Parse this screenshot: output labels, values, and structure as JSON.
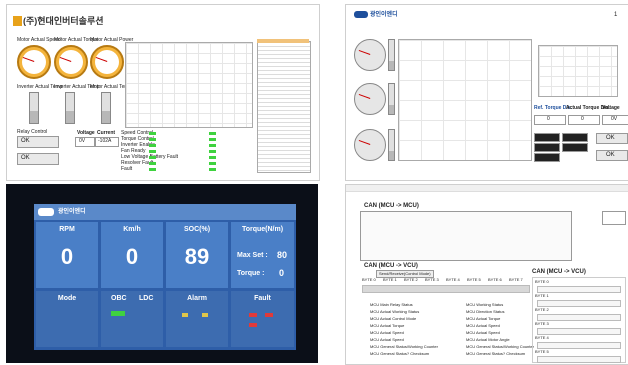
{
  "panel1": {
    "company": "(주)현대인버터솔루션",
    "gauge_labels": [
      "Motor Actual Speed",
      "Motor Actual Torque",
      "Motor Actual Power"
    ],
    "bar_labels": [
      "Inverter Actual Temp",
      "Inverter Actual Temp",
      "Motor Actual Temp"
    ],
    "status_label": "Relay Control",
    "status_ok": "OK",
    "status_ok2": "OK",
    "voltage_label": "Voltage",
    "current_label": "Current",
    "voltage_value": "0V",
    "current_value": "-102A",
    "list_items": [
      "Speed Control",
      "Torque Control",
      "Inverter Enable",
      "Fan Ready",
      "Low Voltage Battery Fault",
      "Resolver Fault",
      "Fault"
    ]
  },
  "panel2": {
    "company": "광인이엔디",
    "corner_label": "1",
    "fields": [
      "Ref. Torque Dis.",
      "Actual Torque Dis.",
      "Voltage",
      "Current"
    ],
    "values": [
      "0",
      "0",
      "0V",
      "-10"
    ],
    "ok_label": "OK",
    "ok_label2": "OK"
  },
  "panel3": {
    "brand": "광인이엔디",
    "tiles_top": [
      {
        "label": "RPM",
        "value": "0"
      },
      {
        "label": "Km/h",
        "value": "0"
      },
      {
        "label": "SOC(%)",
        "value": "89"
      },
      {
        "label": "Torque(N/m)",
        "value": ""
      }
    ],
    "max_set_label": "Max Set :",
    "max_set_value": "80",
    "torque_label": "Torque :",
    "torque_value": "0",
    "tiles_bottom": [
      "Mode",
      "OBC",
      "LDC",
      "Alarm",
      "Fault"
    ]
  },
  "panel4": {
    "title_top": "CAN (MCU -> MCU)",
    "title_mid": "CAN (MCU -> VCU)",
    "title_right": "CAN (MCU -> VCU)",
    "tab_label": "Send/Receive(Control Mode)",
    "bytes": [
      "BYTE 0",
      "BYTE 1",
      "BYTE 2",
      "BYTE 3",
      "BYTE 4",
      "BYTE 5",
      "BYTE 6",
      "BYTE 7"
    ],
    "left_rows": [
      "MCU Main Relay Status",
      "MCU Actual Working Status",
      "MCU Actual Control Mode",
      "MCU Actual Torque",
      "MCU Actual Speed",
      "MCU Actual Speed",
      "MCU General Status/Working Counter",
      "MCU General Status? Checksum"
    ],
    "right_rows": [
      "MCU Working Status",
      "MCU Direction Status",
      "MCU Actual Torque",
      "MCU Actual Speed",
      "MCU Actual Speed",
      "MCU Actual Motor Angle",
      "MCU General Status/Working Counter",
      "MCU General Status? Checksum"
    ],
    "right_block_labels": [
      "BYTE 0",
      "BYTE 1",
      "BYTE 2",
      "BYTE 3",
      "BYTE 4",
      "BYTE 5"
    ]
  }
}
